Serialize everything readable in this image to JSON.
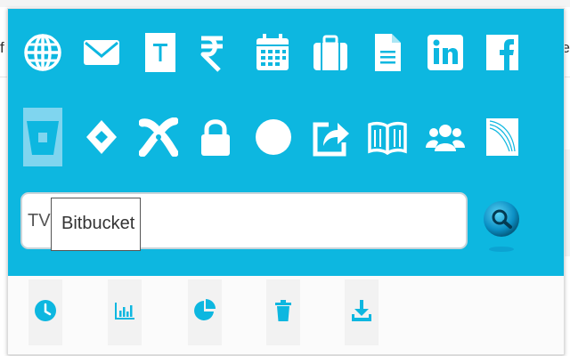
{
  "background": {
    "left_fragment": "f",
    "right_fragment": "e"
  },
  "popup": {
    "colors": {
      "panel": "#0db7e0",
      "icon": "#ffffff",
      "bottom_icon": "#0db7e0"
    },
    "icons_row1": [
      "globe-icon",
      "mail-icon",
      "t-letter-icon",
      "rupee-icon",
      "calendar-icon",
      "briefcase-icon",
      "document-icon",
      "linkedin-icon",
      "facebook-icon"
    ],
    "icons_row2": [
      "bitbucket-icon",
      "jira-icon",
      "confluence-icon",
      "lock-icon",
      "circle-icon",
      "share-icon",
      "book-icon",
      "group-icon",
      "feather-icon"
    ],
    "search": {
      "value": "TV",
      "tooltip": "Bitbucket"
    },
    "bottom_toolbar": [
      "clock-icon",
      "bar-chart-icon",
      "pie-chart-icon",
      "trash-icon",
      "download-icon"
    ]
  }
}
